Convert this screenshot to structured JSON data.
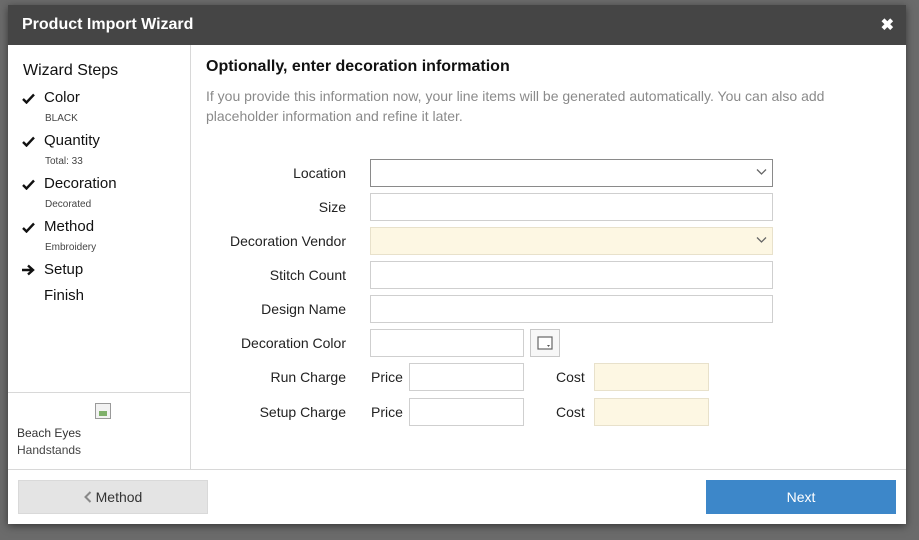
{
  "dialog": {
    "title": "Product Import Wizard",
    "close_icon": "close-icon"
  },
  "sidebar": {
    "heading": "Wizard Steps",
    "steps": [
      {
        "label": "Color",
        "sub": "BLACK",
        "status": "done"
      },
      {
        "label": "Quantity",
        "sub": "Total: 33",
        "status": "done"
      },
      {
        "label": "Decoration",
        "sub": "Decorated",
        "status": "done"
      },
      {
        "label": "Method",
        "sub": "Embroidery",
        "status": "done"
      },
      {
        "label": "Setup",
        "sub": "",
        "status": "current"
      },
      {
        "label": "Finish",
        "sub": "",
        "status": "pending"
      }
    ],
    "product": {
      "name": "Beach Eyes",
      "line2": "Handstands"
    }
  },
  "main": {
    "heading": "Optionally, enter decoration information",
    "help": "If you provide this information now, your line items will be generated automatically. You can also add placeholder information and refine it later.",
    "fields": {
      "location": {
        "label": "Location",
        "value": ""
      },
      "size": {
        "label": "Size",
        "value": ""
      },
      "vendor": {
        "label": "Decoration Vendor",
        "value": ""
      },
      "stitch_count": {
        "label": "Stitch Count",
        "value": ""
      },
      "design_name": {
        "label": "Design Name",
        "value": ""
      },
      "decoration_color": {
        "label": "Decoration Color",
        "value": ""
      },
      "run_charge": {
        "label": "Run Charge",
        "price_label": "Price",
        "cost_label": "Cost",
        "price": "",
        "cost": ""
      },
      "setup_charge": {
        "label": "Setup Charge",
        "price_label": "Price",
        "cost_label": "Cost",
        "price": "",
        "cost": ""
      }
    }
  },
  "footer": {
    "back_label": "Method",
    "next_label": "Next"
  },
  "colors": {
    "titlebar": "#454545",
    "accent": "#3d87c9",
    "highlight_field": "#fdf7e3"
  }
}
